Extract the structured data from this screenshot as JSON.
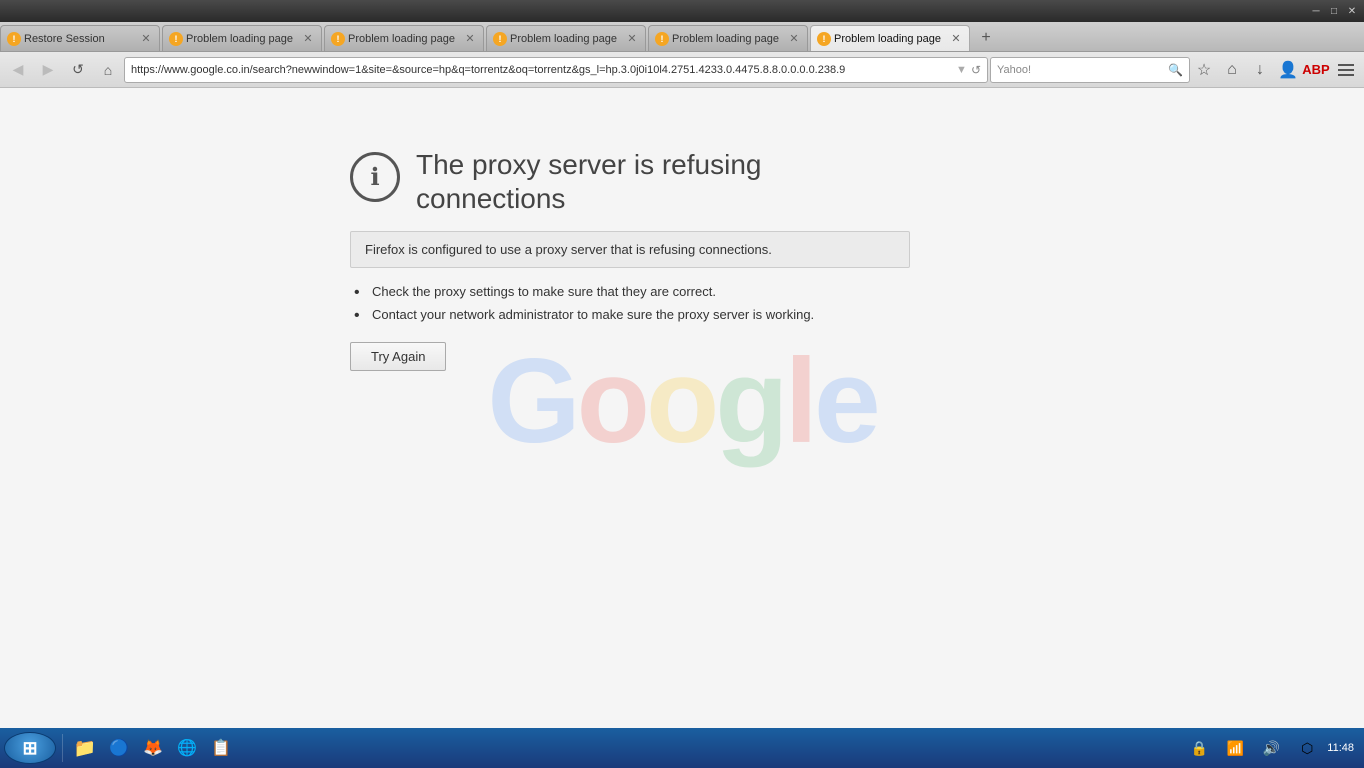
{
  "titlebar": {
    "minimize": "─",
    "maximize": "□",
    "close": "✕"
  },
  "tabs": [
    {
      "id": "tab1",
      "title": "Restore Session",
      "active": false,
      "warn": true
    },
    {
      "id": "tab2",
      "title": "Problem loading page",
      "active": false,
      "warn": true
    },
    {
      "id": "tab3",
      "title": "Problem loading page",
      "active": false,
      "warn": true
    },
    {
      "id": "tab4",
      "title": "Problem loading page",
      "active": false,
      "warn": true
    },
    {
      "id": "tab5",
      "title": "Problem loading page",
      "active": false,
      "warn": true
    },
    {
      "id": "tab6",
      "title": "Problem loading page",
      "active": true,
      "warn": true
    }
  ],
  "navbar": {
    "url": "https://www.google.co.in/search?newwindow=1&site=&source=hp&q=torrentz&oq=torrentz&gs_l=hp.3.0j0i10l4.2751.4233.0.4475.8.8.0.0.0.0.238.9",
    "search_placeholder": "Yahoo!",
    "back_label": "◀",
    "forward_label": "▶",
    "refresh_label": "↺",
    "home_label": "⌂"
  },
  "error": {
    "icon": "ℹ",
    "title": "The proxy server is refusing connections",
    "description": "Firefox is configured to use a proxy server that is refusing connections.",
    "bullet1": "Check the proxy settings to make sure that they are correct.",
    "bullet2": "Contact your network administrator to make sure the proxy server is working.",
    "try_again": "Try Again"
  },
  "google_watermark": "Google",
  "taskbar": {
    "time": "11:48",
    "start_label": "⊞"
  }
}
